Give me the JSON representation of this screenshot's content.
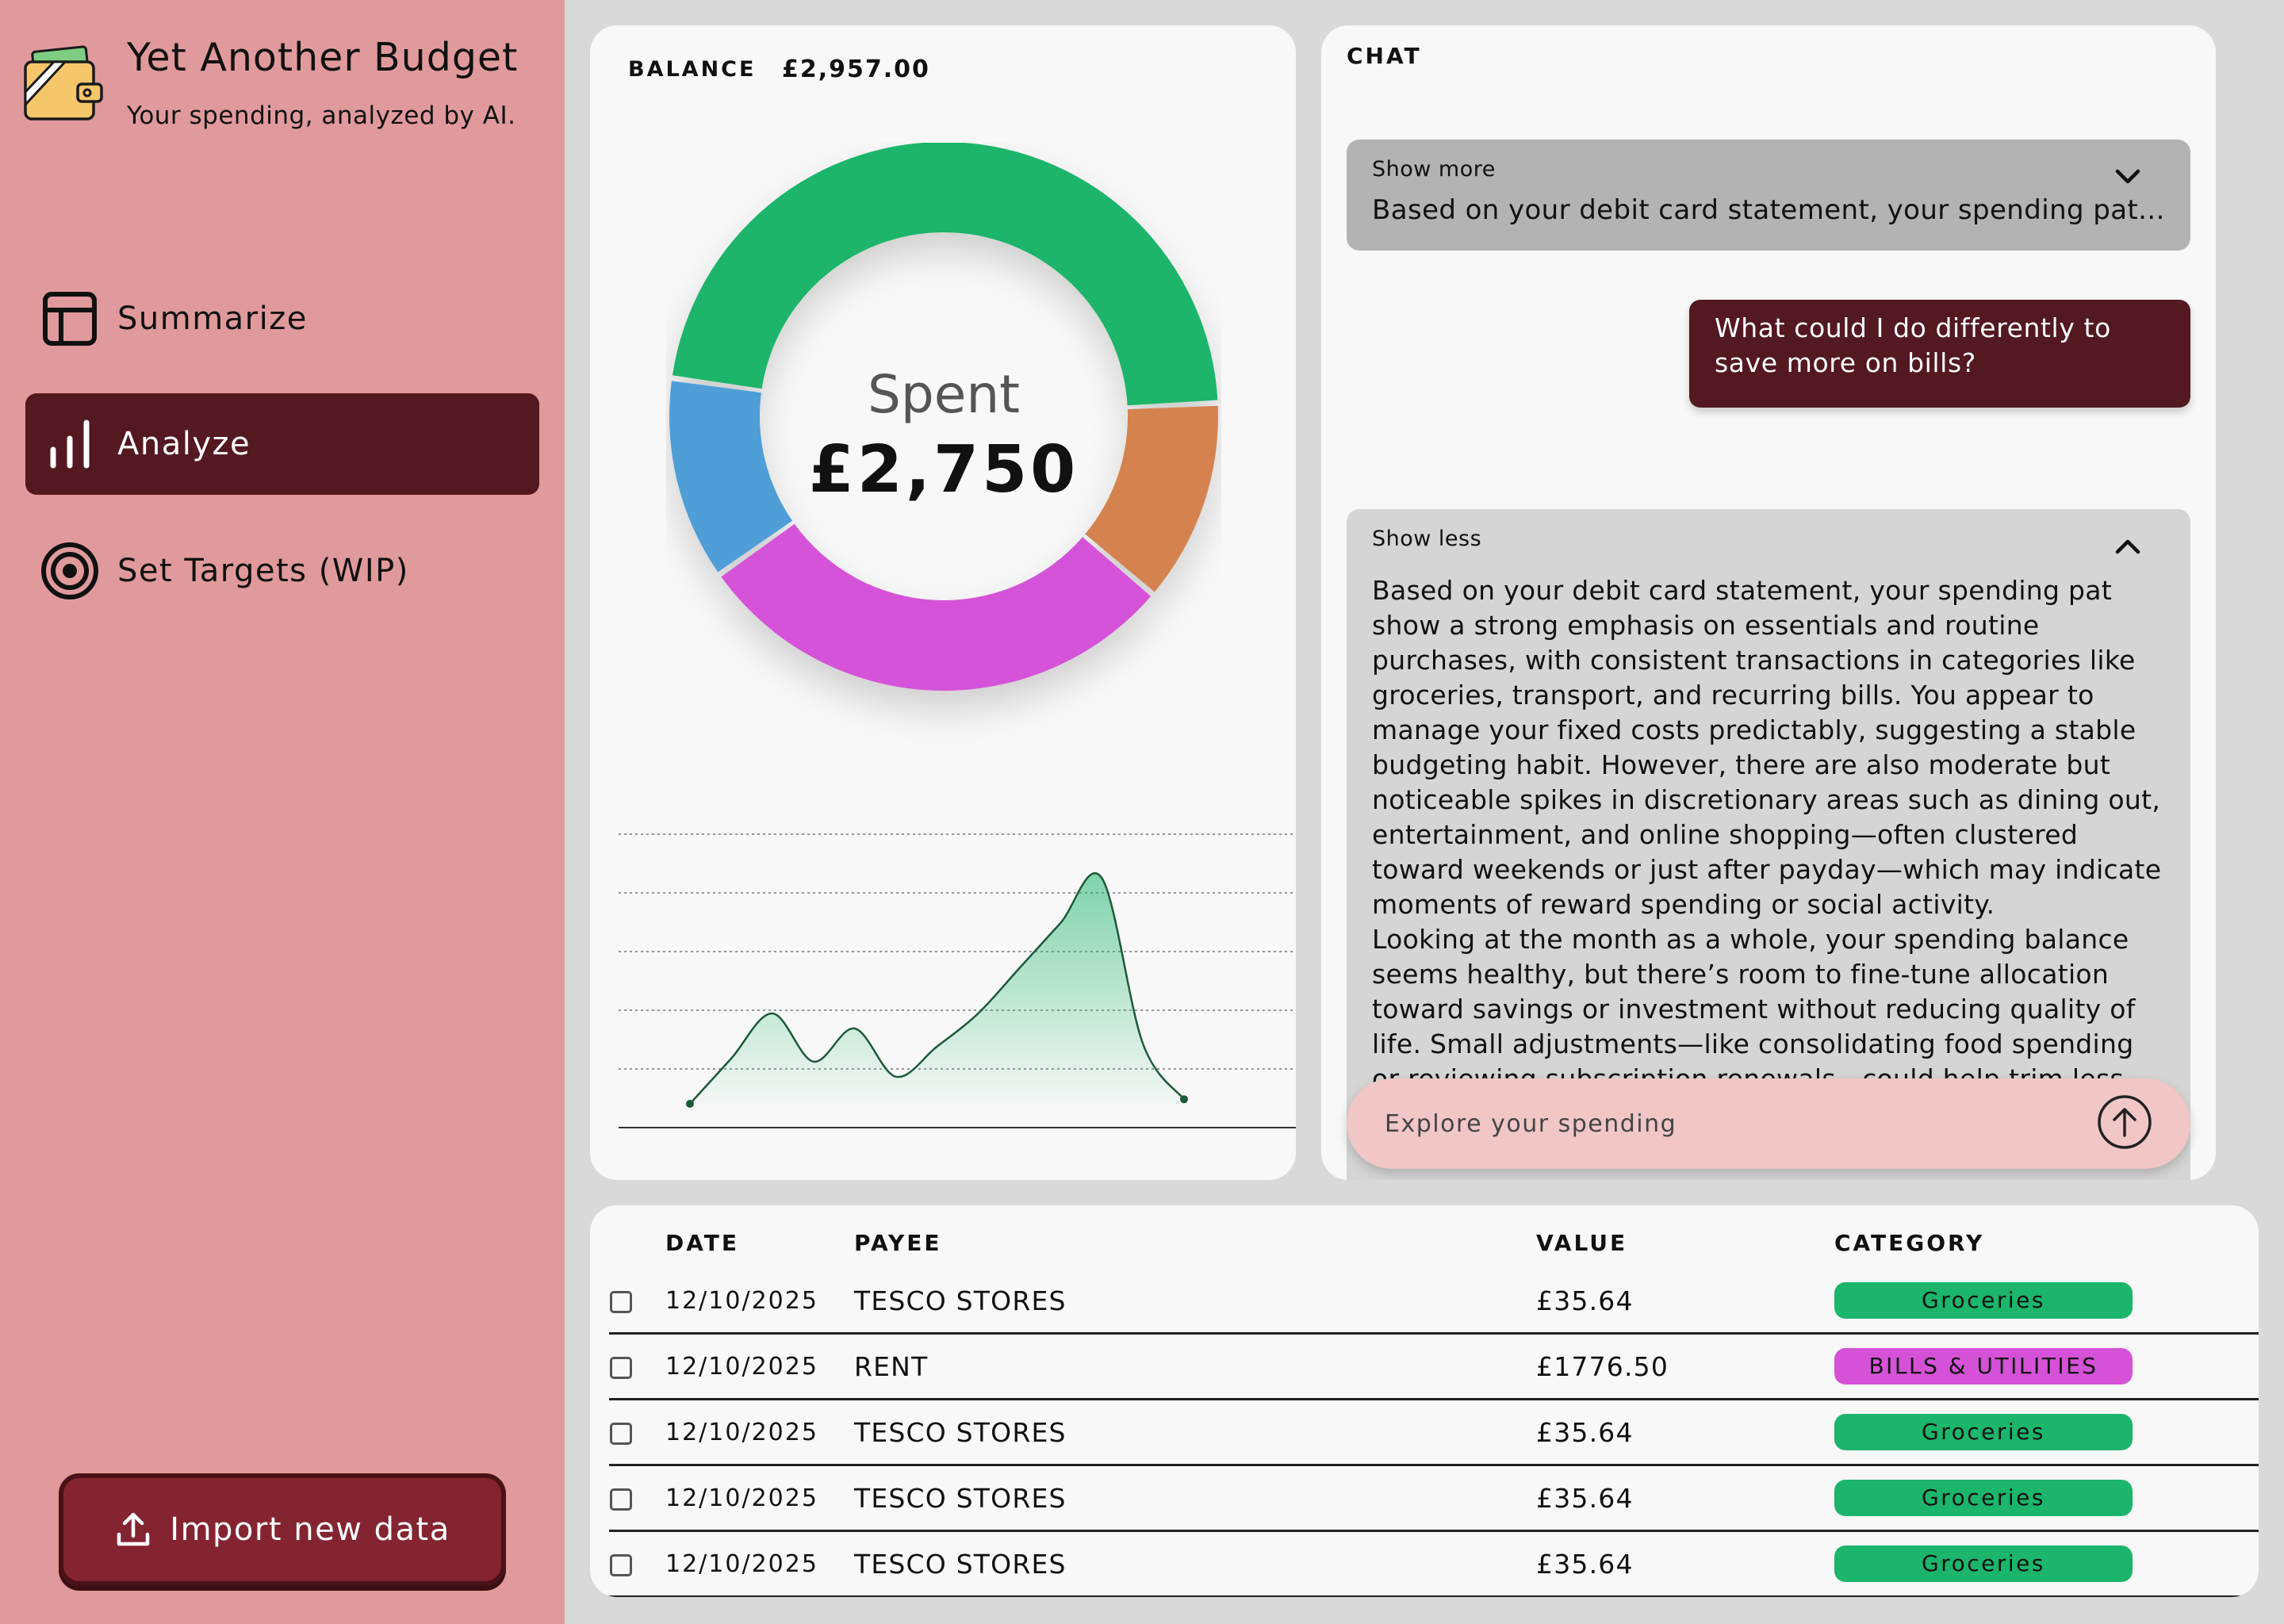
{
  "app": {
    "title": "Yet Another Budget",
    "subtitle": "Your spending, analyzed by AI."
  },
  "nav": [
    {
      "label": "Summarize",
      "icon": "table-layout-icon",
      "active": false
    },
    {
      "label": "Analyze",
      "icon": "bar-chart-icon",
      "active": true
    },
    {
      "label": "Set Targets (WIP)",
      "icon": "target-icon",
      "active": false
    }
  ],
  "import_button": {
    "label": "Import new data",
    "icon": "upload-icon"
  },
  "summary": {
    "balance_label": "BALANCE",
    "balance_value": "£2,957.00",
    "spent_label": "Spent",
    "spent_value": "£2,750"
  },
  "chart_data": [
    {
      "type": "pie",
      "subtype": "donut",
      "title": "",
      "center_text": [
        "Spent",
        "£2,750"
      ],
      "slice_colors": [
        "#1bb56b",
        "#d4834f",
        "#d552d8",
        "#4f9ed8"
      ],
      "values": [
        47,
        12,
        29,
        12
      ],
      "unit": "%"
    },
    {
      "type": "area",
      "title": "",
      "x": [
        0,
        1,
        2,
        3,
        4,
        5,
        6,
        7,
        8,
        9,
        10,
        11,
        12
      ],
      "values": [
        0,
        30,
        60,
        28,
        50,
        18,
        38,
        60,
        90,
        120,
        150,
        40,
        3
      ],
      "ylim": [
        0,
        180
      ],
      "grid": true,
      "color": "#1d6b42"
    }
  ],
  "chat": {
    "title": "CHAT",
    "messages": [
      {
        "role": "assistant",
        "collapsed": true,
        "toggle_label": "Show more",
        "text": "Based on your debit card statement, your spending pat..."
      },
      {
        "role": "user",
        "text": "What could I do differently to save more on bills?"
      },
      {
        "role": "assistant",
        "collapsed": false,
        "toggle_label": "Show less",
        "text": "Based on your debit card statement, your spending pat\n show a strong emphasis on essentials and routine purchases, with consistent transactions in categories like groceries, transport, and recurring bills. You appear to manage your fixed costs predictably, suggesting a stable budgeting habit. However, there are also moderate but noticeable spikes in discretionary areas such as dining out, entertainment, and online shopping—often clustered toward weekends or just after payday—which may indicate moments of reward spending or social activity.\nLooking at the month as a whole, your spending balance seems healthy, but there’s room to fine-tune allocation toward savings or investment without reducing quality of life. Small adjustments—like consolidating food spending or reviewing subscription renewals—could help trim less essential costs. redirect surplus cash toward long-term goals"
      }
    ],
    "input_placeholder": "Explore your spending"
  },
  "table": {
    "columns": [
      "DATE",
      "PAYEE",
      "VALUE",
      "CATEGORY"
    ],
    "rows": [
      {
        "date": "12/10/2025",
        "payee": "TESCO STORES",
        "value": "£35.64",
        "category": "Groceries",
        "category_color": "#1bb56b"
      },
      {
        "date": "12/10/2025",
        "payee": "RENT",
        "value": "£1776.50",
        "category": "BILLS & UTILITIES",
        "category_color": "#d552d8"
      },
      {
        "date": "12/10/2025",
        "payee": "TESCO STORES",
        "value": "£35.64",
        "category": "Groceries",
        "category_color": "#1bb56b"
      },
      {
        "date": "12/10/2025",
        "payee": "TESCO STORES",
        "value": "£35.64",
        "category": "Groceries",
        "category_color": "#1bb56b"
      },
      {
        "date": "12/10/2025",
        "payee": "TESCO STORES",
        "value": "£35.64",
        "category": "Groceries",
        "category_color": "#1bb56b"
      }
    ]
  },
  "colors": {
    "sidebar": "#e19a9c",
    "accent_dark": "#531820",
    "import_button": "#842430",
    "chat_input": "#f0c6c7"
  }
}
